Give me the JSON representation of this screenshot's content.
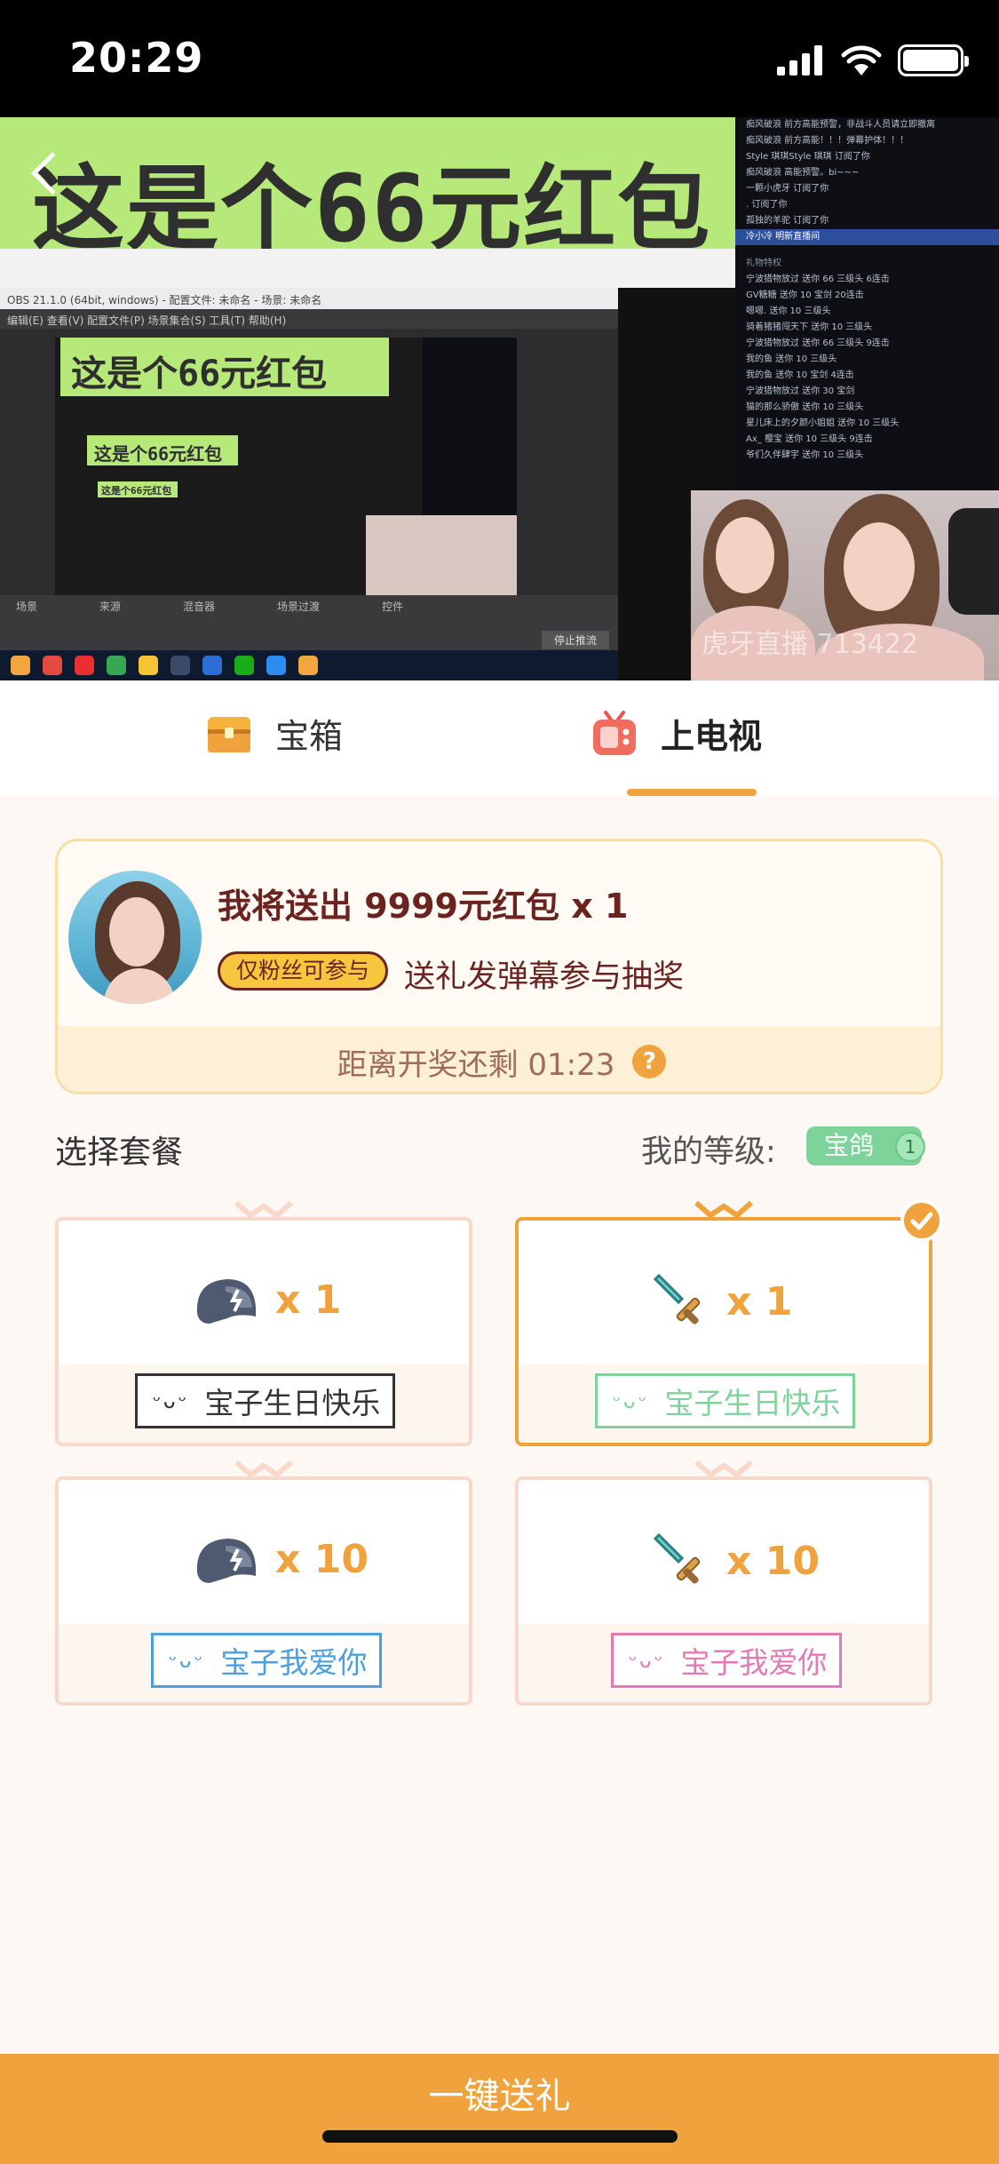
{
  "status_bar": {
    "time": "20:29"
  },
  "video": {
    "banner_text": "这是个66元红包",
    "obs_title": "OBS 21.1.0 (64bit, windows) - 配置文件: 未命名 - 场景: 未命名",
    "obs_menu": "编辑(E)   查看(V)   配置文件(P)   场景集合(S)   工具(T)   帮助(H)",
    "obs_docks": [
      "场景",
      "来源",
      "混音器",
      "场景过渡",
      "控件"
    ],
    "stop_stream": "停止推流",
    "chat_lines": [
      "痴风破浪 前方高能预警，非战斗人员请立即撤离",
      "痴风破浪 前方高能！！！弹幕护体！！！",
      "Style 琪琪Style 琪琪 订阅了你",
      "痴风破浪 高能预警。bi~~~",
      "一颗小虎牙 订阅了你",
      ". 订阅了你",
      "孤独的羊驼 订阅了你",
      "冷小冷 明新直播间",
      "礼物特权",
      "宁波猎物放过 送你 66 三级头 6连击",
      "GV糖糖 送你 10 宝剑 20连击",
      "嗯嗯. 送你 10 三级头",
      "骑着猪猪闯天下 送你 10 三级头",
      "宁波猎物放过 送你 66 三级头 9连击",
      "我的鱼 送你 10 三级头",
      "我的鱼 送你 10 宝剑 4连击",
      "宁波猎物放过 送你 30 宝剑",
      "猫的那么骄傲 送你 10 三级头",
      "星儿床上的夕颜小姐姐 送你 10 三级头",
      "Ax_ 樱宝 送你 10 三级头 9连击",
      "爷们久伴肆宇 送你 10 三级头"
    ],
    "watermark": "虎牙直播 713422"
  },
  "tabs": [
    {
      "label": "宝箱",
      "icon": "treasure-chest-icon"
    },
    {
      "label": "上电视",
      "icon": "tv-icon"
    }
  ],
  "event": {
    "title": "我将送出 9999元红包 x 1",
    "badge": "仅粉丝可参与",
    "description": "送礼发弹幕参与抽奖",
    "countdown": "距离开奖还剩 01:23",
    "help": "?"
  },
  "packages_section": {
    "title": "选择套餐",
    "level_label": "我的等级:",
    "level_badge": "宝鸽",
    "level_num": "1"
  },
  "packages": [
    {
      "qty": "x 1",
      "gift_icon": "helmet-icon",
      "message": "宝子生日快乐",
      "emoticon": "ᵕᴗᵕ",
      "color": "#333333",
      "selected": false
    },
    {
      "qty": "x 1",
      "gift_icon": "sword-icon",
      "message": "宝子生日快乐",
      "emoticon": "ᵕᴗᵕ",
      "color": "#7ed39a",
      "selected": true
    },
    {
      "qty": "x 10",
      "gift_icon": "helmet-icon",
      "message": "宝子我爱你",
      "emoticon": "ᵕᴗᵕ",
      "color": "#4a9fe0",
      "selected": false
    },
    {
      "qty": "x 10",
      "gift_icon": "sword-icon",
      "message": "宝子我爱你",
      "emoticon": "ᵕᴗᵕ",
      "color": "#e579b5",
      "selected": false
    }
  ],
  "bottom_button": {
    "label": "一键送礼"
  },
  "colors": {
    "accent": "#f0a23d",
    "card_border": "#f7dfaa",
    "dark_red": "#6b2320"
  }
}
